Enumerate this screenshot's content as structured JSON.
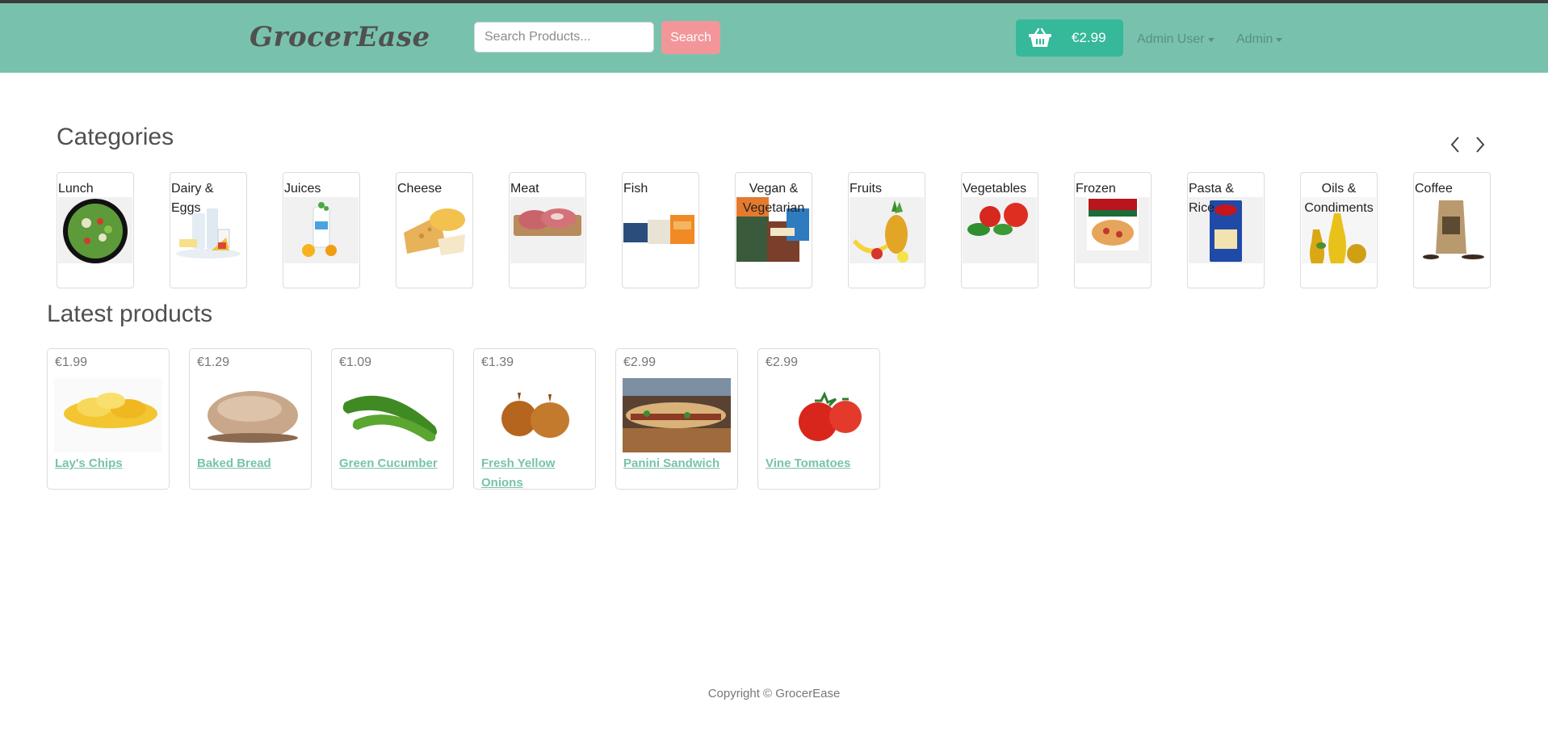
{
  "navbar": {
    "brand": "GrocerEase",
    "search_placeholder": "Search Products...",
    "search_button": "Search",
    "cart_total": "€2.99",
    "user_menu": "Admin User",
    "admin_menu": "Admin"
  },
  "categories_section": {
    "title": "Categories",
    "items": [
      {
        "label": "Lunch"
      },
      {
        "label": "Dairy & Eggs"
      },
      {
        "label": "Juices"
      },
      {
        "label": "Cheese"
      },
      {
        "label": "Meat"
      },
      {
        "label": "Fish"
      },
      {
        "label": "Vegan & Vegetarian"
      },
      {
        "label": "Fruits"
      },
      {
        "label": "Vegetables"
      },
      {
        "label": "Frozen"
      },
      {
        "label": "Pasta & Rice"
      },
      {
        "label": "Oils & Condiments"
      },
      {
        "label": "Coffee"
      }
    ]
  },
  "latest_section": {
    "title": "Latest products",
    "products": [
      {
        "price": "€1.99",
        "name": "Lay's Chips"
      },
      {
        "price": "€1.29",
        "name": "Baked Bread"
      },
      {
        "price": "€1.09",
        "name": "Green Cucumber"
      },
      {
        "price": "€1.39",
        "name": "Fresh Yellow Onions"
      },
      {
        "price": "€2.99",
        "name": "Panini Sandwich"
      },
      {
        "price": "€2.99",
        "name": "Vine Tomatoes"
      }
    ]
  },
  "footer": {
    "copyright": "Copyright © GrocerEase"
  },
  "colors": {
    "navbar_bg": "#78c2ad",
    "search_button_bg": "#f3969a",
    "cart_button_bg": "#36b89a",
    "link_color": "#78c2ad"
  },
  "icons": {
    "cart": "basket-icon",
    "prev": "chevron-left-icon",
    "next": "chevron-right-icon"
  }
}
